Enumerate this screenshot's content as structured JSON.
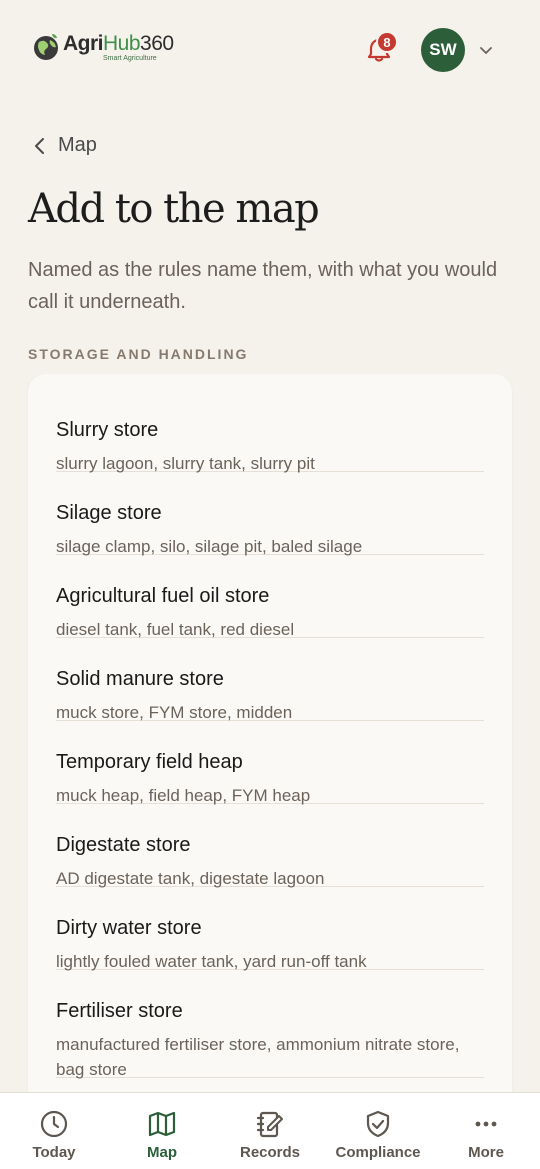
{
  "header": {
    "logo": {
      "agri": "Agri",
      "hub": "Hub",
      "num": "360",
      "tagline": "Smart Agriculture"
    },
    "notifications_count": "8",
    "avatar_initials": "SW"
  },
  "breadcrumb": {
    "back_label": "Map"
  },
  "page": {
    "title": "Add to the map",
    "subtitle": "Named as the rules name them, with what you would call it underneath."
  },
  "section": {
    "label": "STORAGE AND HANDLING",
    "items": [
      {
        "name": "Slurry store",
        "aliases": "slurry lagoon, slurry tank, slurry pit"
      },
      {
        "name": "Silage store",
        "aliases": "silage clamp, silo, silage pit, baled silage"
      },
      {
        "name": "Agricultural fuel oil store",
        "aliases": "diesel tank, fuel tank, red diesel"
      },
      {
        "name": "Solid manure store",
        "aliases": "muck store, FYM store, midden"
      },
      {
        "name": "Temporary field heap",
        "aliases": "muck heap, field heap, FYM heap"
      },
      {
        "name": "Digestate store",
        "aliases": "AD digestate tank, digestate lagoon"
      },
      {
        "name": "Dirty water store",
        "aliases": "lightly fouled water tank, yard run-off tank"
      },
      {
        "name": "Fertiliser store",
        "aliases": "manufactured fertiliser store, ammonium nitrate store, bag store"
      }
    ]
  },
  "tabbar": {
    "tabs": [
      {
        "label": "Today",
        "icon": "clock-icon"
      },
      {
        "label": "Map",
        "icon": "map-icon",
        "active": true
      },
      {
        "label": "Records",
        "icon": "notebook-icon"
      },
      {
        "label": "Compliance",
        "icon": "shield-check-icon"
      },
      {
        "label": "More",
        "icon": "ellipsis-icon"
      }
    ]
  },
  "colors": {
    "background": "#f5f2ec",
    "accent": "#2c5e3a",
    "badge": "#c43a30",
    "card": "#fbf9f6"
  }
}
